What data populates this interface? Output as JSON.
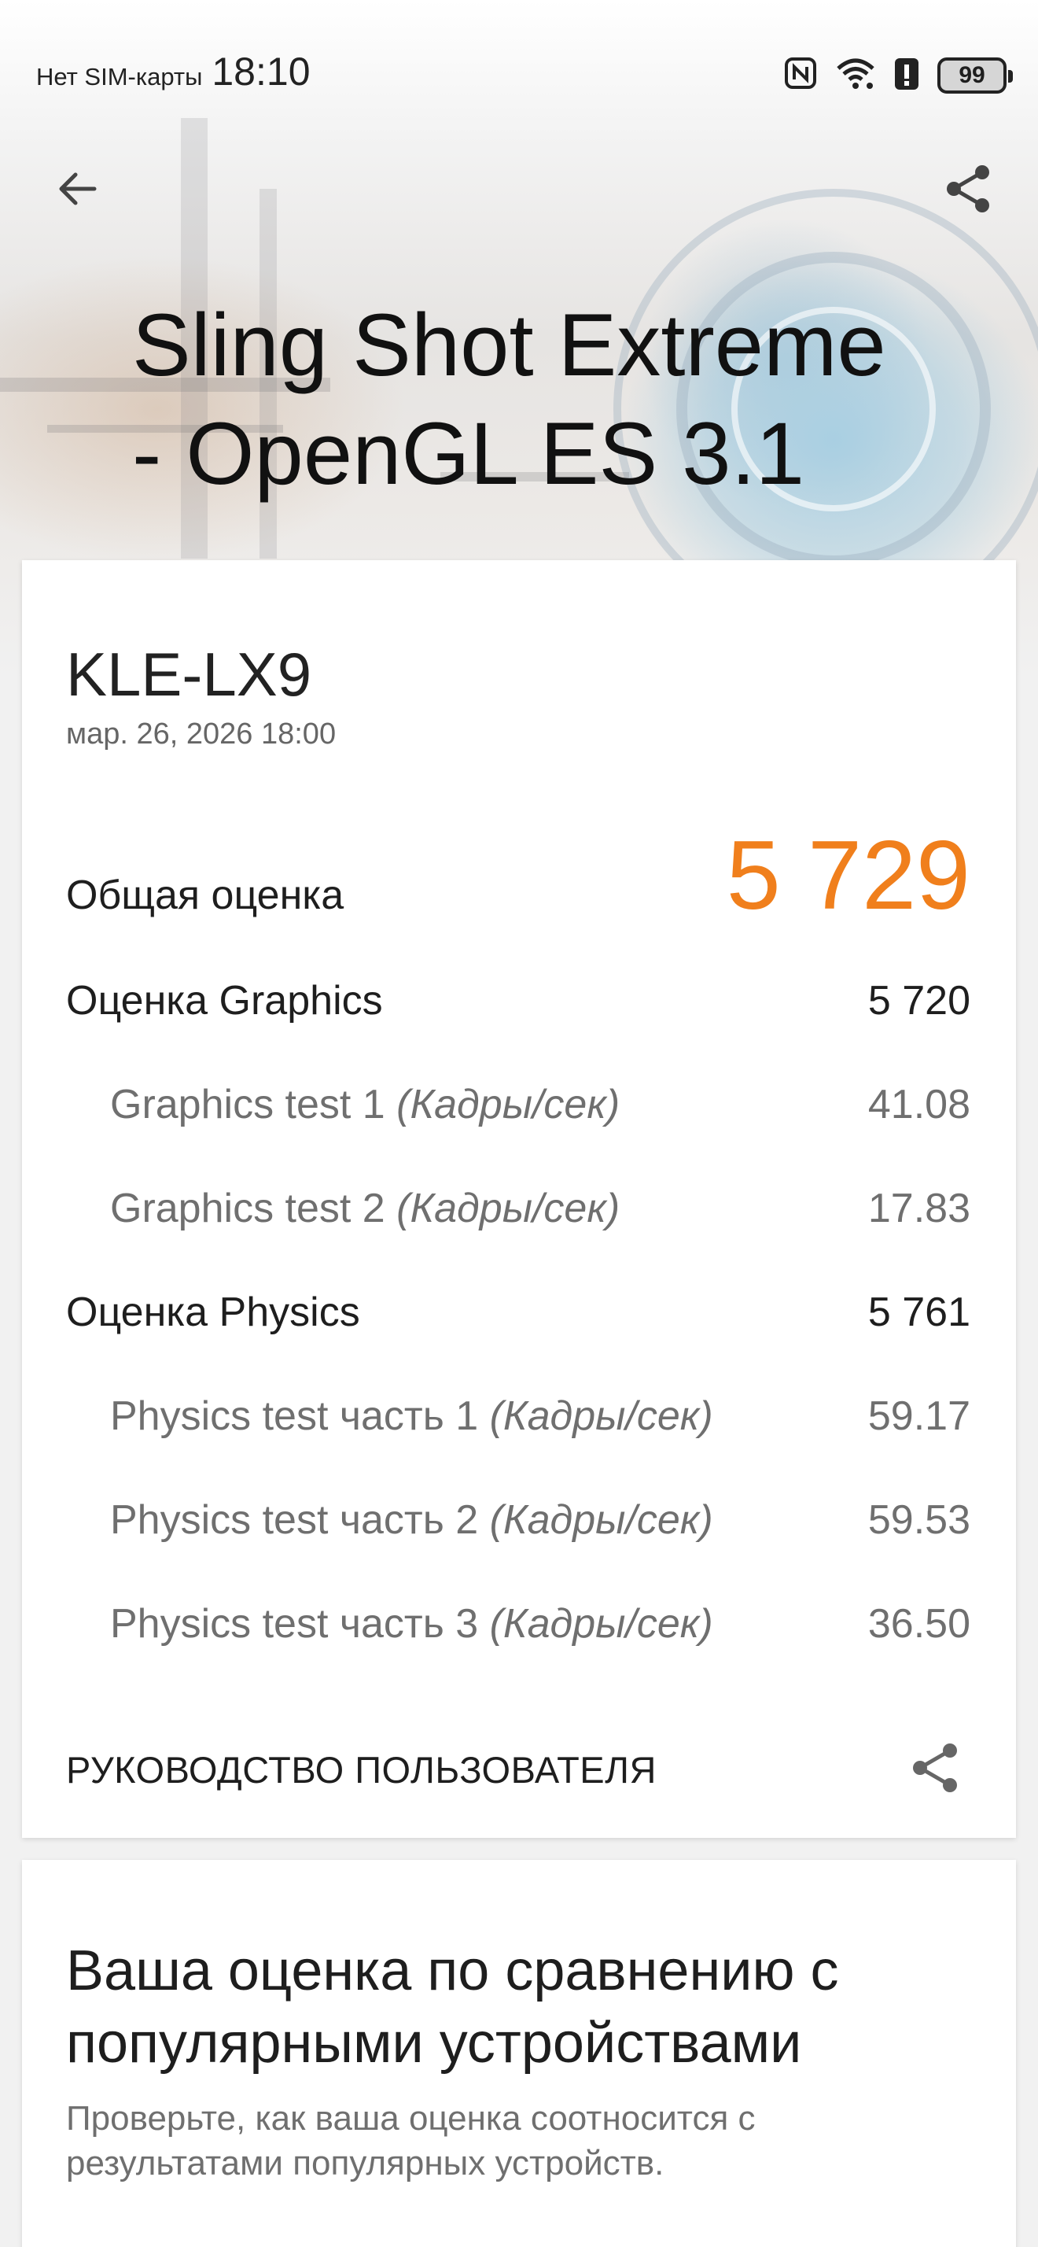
{
  "status_bar": {
    "sim_text": "Нет SIM-карты",
    "time": "18:10",
    "battery": "99",
    "icons": [
      "nfc-icon",
      "wifi-icon",
      "alert-icon",
      "battery-icon"
    ]
  },
  "header": {
    "back_icon": "arrow-left-icon",
    "share_icon": "share-icon",
    "title_line1": "Sling Shot Extreme",
    "title_line2": "- OpenGL ES 3.1"
  },
  "result": {
    "device": "KLE-LX9",
    "date": "мар. 26, 2026 18:00",
    "total_label": "Общая оценка",
    "total_value": "5 729",
    "graphics_label": "Оценка Graphics",
    "graphics_value": "5 720",
    "graphics_tests": [
      {
        "label": "Graphics test 1",
        "unit": "(Кадры/сек)",
        "value": "41.08"
      },
      {
        "label": "Graphics test 2",
        "unit": "(Кадры/сек)",
        "value": "17.83"
      }
    ],
    "physics_label": "Оценка Physics",
    "physics_value": "5 761",
    "physics_tests": [
      {
        "label": "Physics test часть 1",
        "unit": "(Кадры/сек)",
        "value": "59.17"
      },
      {
        "label": "Physics test часть 2",
        "unit": "(Кадры/сек)",
        "value": "59.53"
      },
      {
        "label": "Physics test часть 3",
        "unit": "(Кадры/сек)",
        "value": "36.50"
      }
    ],
    "guide_label": "РУКОВОДСТВО ПОЛЬЗОВАТЕЛЯ"
  },
  "compare": {
    "title": "Ваша оценка по сравнению с популярными устройствами",
    "description": "Проверьте, как ваша оценка соотносится с результатами популярных устройств."
  },
  "colors": {
    "accent": "#f07f1c",
    "text": "#1e1e1e",
    "muted": "#6f6f6f"
  }
}
